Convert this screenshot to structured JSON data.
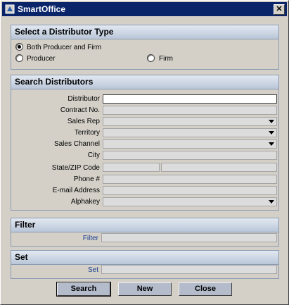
{
  "window": {
    "title": "SmartOffice"
  },
  "distributor_type": {
    "heading": "Select a Distributor Type",
    "options": [
      {
        "label": "Both Producer and Firm",
        "checked": true
      },
      {
        "label": "Producer",
        "checked": false
      },
      {
        "label": "Firm",
        "checked": false
      }
    ]
  },
  "search": {
    "heading": "Search Distributors",
    "fields": {
      "distributor": "Distributor",
      "contract_no": "Contract No.",
      "sales_rep": "Sales Rep",
      "territory": "Territory",
      "sales_channel": "Sales Channel",
      "city": "City",
      "state_zip": "State/ZIP Code",
      "phone": "Phone #",
      "email": "E-mail Address",
      "alphakey": "Alphakey"
    }
  },
  "filter": {
    "heading": "Filter",
    "label": "Filter"
  },
  "set": {
    "heading": "Set",
    "label": "Set"
  },
  "buttons": {
    "search": "Search",
    "new": "New",
    "close": "Close"
  }
}
